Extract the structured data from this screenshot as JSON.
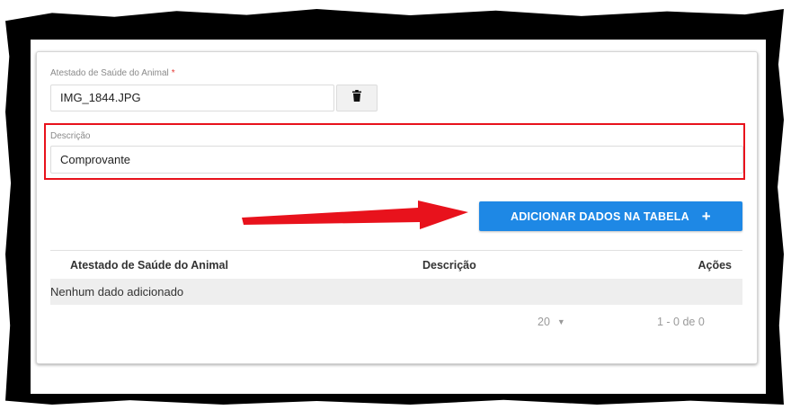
{
  "form": {
    "attachment_label": "Atestado de Saúde do Animal",
    "required_mark": "*",
    "attachment_filename": "IMG_1844.JPG",
    "description_label": "Descrição",
    "description_value": "Comprovante",
    "add_button_label": "ADICIONAR DADOS NA TABELA",
    "add_button_icon": "plus-icon"
  },
  "table": {
    "columns": [
      "Atestado de Saúde do Animal",
      "Descrição",
      "Ações"
    ],
    "empty_text": "Nenhum dado adicionado",
    "page_size": "20",
    "range_text": "1 - 0 de 0"
  },
  "annotations": {
    "highlight_color": "#e8121c",
    "arrow_color": "#e8121c"
  },
  "colors": {
    "primary_button": "#1e88e5",
    "required": "#e53935"
  }
}
